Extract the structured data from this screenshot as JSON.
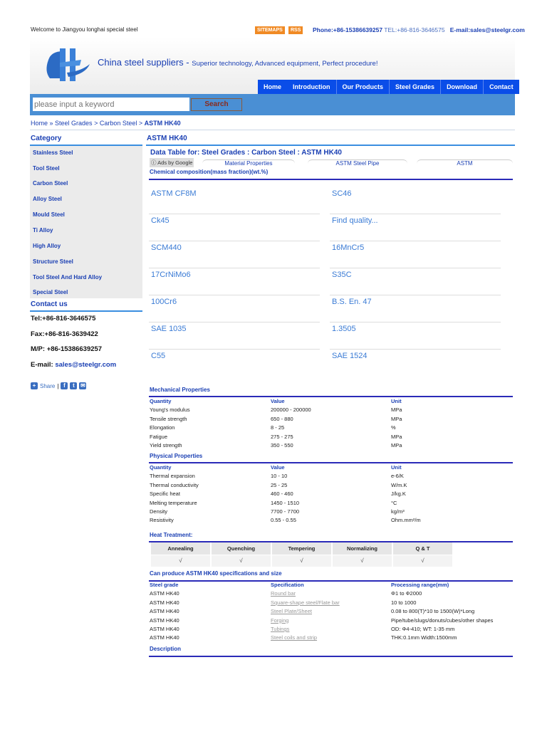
{
  "topbar": {
    "welcome": "Welcome to Jiangyou longhai special steel",
    "sitemaps": "SITEMAPS",
    "rss": "RSS",
    "phone": "Phone:+86-15386639257",
    "tel": "TEL:+86-816-3646575",
    "email": "E-mail:sales@steelgr.com"
  },
  "header": {
    "slogan_main": "China steel suppliers - ",
    "slogan_sub": "Superior technology, Advanced equipment, Perfect procedure!"
  },
  "nav": [
    "Home",
    "Introduction",
    "Our Products",
    "Steel Grades",
    "Download",
    "Contact"
  ],
  "search": {
    "placeholder": "please input a keyword",
    "button": "Search"
  },
  "breadcrumb": {
    "home": "Home",
    "sep1": " » ",
    "steel_grades": "Steel Grades",
    "sep2": " > ",
    "carbon": "Carbon Steel",
    "sep3": " > ",
    "current": "ASTM HK40"
  },
  "sidebar": {
    "category_title": "Category",
    "categories": [
      "Stainless Steel",
      "Tool Steel",
      "Carbon Steel",
      "Alloy Steel",
      "Mould Steel",
      "Ti Alloy",
      "High Alloy",
      "Structure Steel",
      "Tool Steel And Hard Alloy",
      "Special Steel"
    ],
    "contact_title": "Contact us",
    "tel": "Tel:+86-816-3646575",
    "fax": "Fax:+86-816-3639422",
    "mp": "M/P: +86-15386639257",
    "email_label": "E-mail: ",
    "email": "sales@steelgr.com",
    "share": "Share"
  },
  "main": {
    "title": "ASTM HK40",
    "data_table_title": "Data Table for: Steel Grades : Carbon Steel : ASTM HK40",
    "ads": "ⓘ Ads by Google",
    "ad_tabs": [
      "Material Properties",
      "ASTM Steel Pipe",
      "ASTM"
    ],
    "chem_title": "Chemical composition(mass fraction)(wt.%)",
    "grades": [
      "ASTM CF8M",
      "SC46",
      "Ck45",
      "Find quality...",
      "SCM440",
      "16MnCr5",
      "17CrNiMo6",
      "S35C",
      "100Cr6",
      "B.S. En. 47",
      "SAE 1035",
      "1.3505",
      "C55",
      "SAE 1524"
    ],
    "mech_title": "Mechanical Properties",
    "headers": [
      "Quantity",
      "Value",
      "Unit"
    ],
    "mech_rows": [
      [
        "Young's modulus",
        "200000 - 200000",
        "MPa"
      ],
      [
        "Tensile strength",
        "650 - 880",
        "MPa"
      ],
      [
        "Elongation",
        "8 - 25",
        "%"
      ],
      [
        "Fatigue",
        "275 - 275",
        "MPa"
      ],
      [
        "Yield strength",
        "350 - 550",
        "MPa"
      ]
    ],
    "phys_title": "Physical Properties",
    "phys_rows": [
      [
        "Thermal expansion",
        "10 - 10",
        "e-6/K"
      ],
      [
        "Thermal conductivity",
        "25 - 25",
        "W/m.K"
      ],
      [
        "Specific heat",
        "460 - 460",
        "J/kg.K"
      ],
      [
        "Melting temperature",
        "1450 - 1510",
        "°C"
      ],
      [
        "Density",
        "7700 - 7700",
        "kg/m³"
      ],
      [
        "Resistivity",
        "0.55 - 0.55",
        "Ohm.mm²/m"
      ]
    ],
    "heat_title": "Heat Treatment:",
    "heat_headers": [
      "Annealing",
      "Quenching",
      "Tempering",
      "Normalizing",
      "Q & T"
    ],
    "heat_values": [
      "√",
      "√",
      "√",
      "√",
      "√"
    ],
    "spec_title": "Can produce ASTM HK40 specifications and size",
    "spec_headers": [
      "Steel grade",
      "Specification",
      "Processing range(mm)"
    ],
    "spec_rows": [
      [
        "ASTM HK40",
        "Round bar",
        "Φ1 to Φ2000"
      ],
      [
        "ASTM HK40",
        "Square-shape steel/Flate bar",
        "10 to 1000"
      ],
      [
        "ASTM HK40",
        "Steel Plate/Sheet",
        "0.08 to 800(T)*10 to 1500(W)*Long"
      ],
      [
        "ASTM HK40",
        "Forging",
        "Pipe/tube/slugs/donuts/cubes/other shapes"
      ],
      [
        "ASTM HK40",
        "Tubings",
        "OD: Φ4-410; WT: 1-35 mm"
      ],
      [
        "ASTM HK40",
        "Steel coils and strip",
        "THK:0.1mm Width:1500mm"
      ]
    ],
    "desc_title": "Description"
  }
}
